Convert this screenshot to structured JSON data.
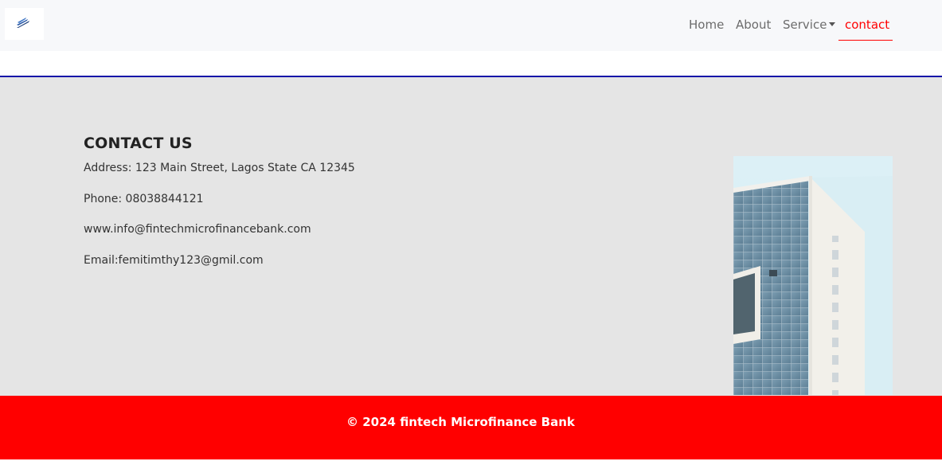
{
  "nav": {
    "logo_icon": "bank-wing-logo",
    "items": [
      {
        "label": "Home"
      },
      {
        "label": "About"
      },
      {
        "label": "Service",
        "has_dropdown": true
      },
      {
        "label": "contact",
        "active": true
      }
    ],
    "active_color": "#ff0000"
  },
  "contact": {
    "title": "CONTACT US",
    "address": "Address: 123 Main Street, Lagos State CA 12345",
    "phone": "Phone: 08038844121",
    "website": "www.info@fintechmicrofinancebank.com",
    "email": "Email:femitimthy123@gmil.com",
    "image": "office-building-photo"
  },
  "footer": {
    "text": "© 2024 fintech Microfinance Bank",
    "background": "#ff0000"
  },
  "colors": {
    "navbar_bg": "#f7f8fa",
    "section_bg": "#e5e5e5",
    "rule": "#1313a8"
  }
}
